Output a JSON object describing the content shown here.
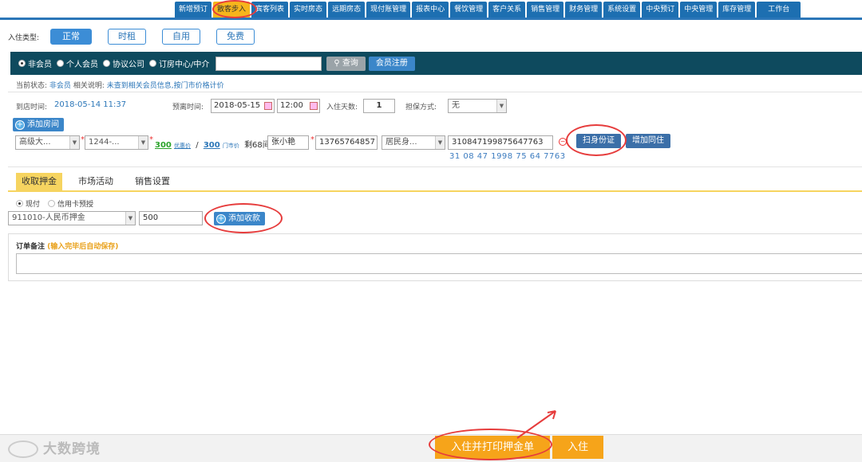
{
  "nav": {
    "tabs": [
      "新增预订",
      "散客步入",
      "宾客列表",
      "实时房态",
      "远期房态",
      "现付账管理",
      "报表中心",
      "餐饮管理",
      "客户关系",
      "销售管理",
      "财务管理",
      "系统设置",
      "中央预订",
      "中央管理",
      "库存管理",
      "工作台"
    ]
  },
  "stay_type": {
    "label": "入住类型:",
    "options": [
      "正常",
      "时租",
      "自用",
      "免费"
    ]
  },
  "member": {
    "options": [
      "非会员",
      "个人会员",
      "协议公司",
      "订房中心/中介"
    ],
    "search_value": "",
    "query_label": "查询",
    "register_label": "会员注册"
  },
  "status": {
    "label": "当前状态:",
    "value": "非会员",
    "desc_label": "相关说明:",
    "desc": "未查到相关会员信息,按门市价格计价"
  },
  "arrival": {
    "arrive_label": "到店时间:",
    "arrive_value": "2018-05-14  11:37",
    "depart_label": "预离时间:",
    "depart_date": "2018-05-15",
    "depart_time": "12:00",
    "days_label": "入住天数:",
    "days_value": "1",
    "guarantee_label": "担保方式:",
    "guarantee_value": "无"
  },
  "room": {
    "add_room_label": "添加房间",
    "room_type": "高级大...",
    "room_no": "1244-...",
    "discount_price": "300",
    "discount_label": "优惠价",
    "slash": "/",
    "rack_price": "300",
    "rack_label": "门市价",
    "remain": "剩68间",
    "guest_name": "张小艳",
    "phone": "13765764857",
    "id_type": "居民身...",
    "id_number": "310847199875647763",
    "id_split": "31 08 47 1998 75 64 7763",
    "scan_label": "扫身份证",
    "add_guest_label": "增加同住"
  },
  "sections": {
    "tabs": [
      "收取押金",
      "市场活动",
      "销售设置"
    ]
  },
  "payment": {
    "options": [
      "现付",
      "信用卡预授"
    ],
    "deposit_item": "911010-人民币押金",
    "amount": "500",
    "add_pay_label": "添加收款"
  },
  "note": {
    "label": "订单备注",
    "hint": "(输入完毕后自动保存)",
    "value": ""
  },
  "actions": {
    "print_label": "入住并打印押金单",
    "checkin_label": "入住"
  },
  "watermark": "大数跨境",
  "colors": {
    "nav_blue": "#1d6fb1",
    "active_tab": "#f6b51c",
    "member_bar": "#0e4a5e",
    "action_orange": "#f6a41a",
    "highlight_red": "#e63c3c"
  }
}
